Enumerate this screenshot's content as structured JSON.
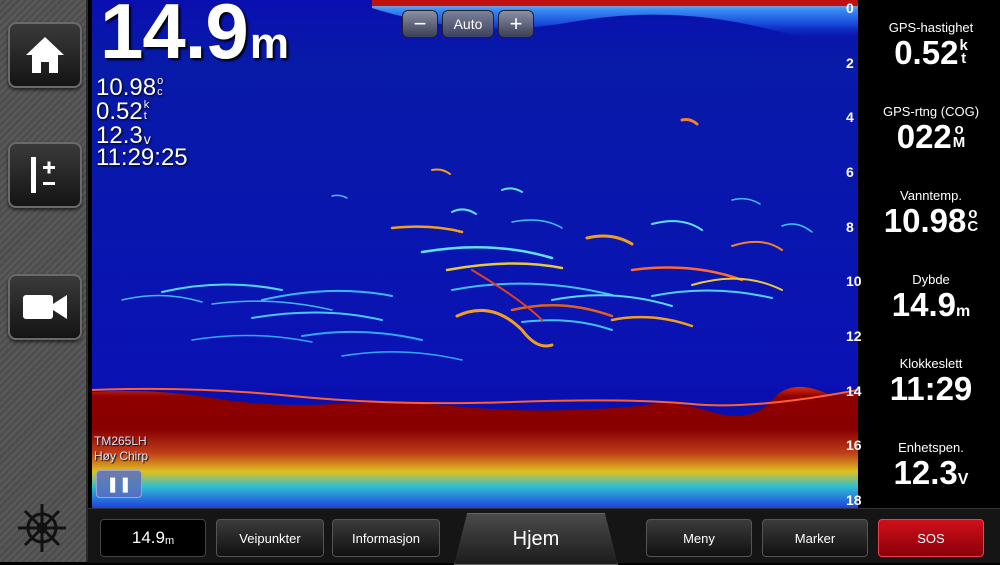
{
  "overlay": {
    "depth_value": "14.9",
    "depth_unit": "m",
    "water_temp": "10.98",
    "water_temp_unit_a": "o",
    "water_temp_unit_b": "c",
    "speed": "0.52",
    "speed_unit_a": "k",
    "speed_unit_b": "t",
    "voltage": "12.3",
    "voltage_unit": "v",
    "time": "11:29:25",
    "transducer": "TM265LH",
    "frequency": "Høy Chirp"
  },
  "zoom": {
    "minus": "−",
    "mode": "Auto",
    "plus": "+"
  },
  "depth_scale": [
    "0",
    "2",
    "4",
    "6",
    "8",
    "10",
    "12",
    "14",
    "16",
    "18"
  ],
  "data_fields": [
    {
      "label": "GPS-hastighet",
      "value": "0.52",
      "unit_a": "k",
      "unit_b": "t"
    },
    {
      "label": "GPS-rtng (COG)",
      "value": "022",
      "unit_a": "o",
      "unit_b": "M"
    },
    {
      "label": "Vanntemp.",
      "value": "10.98",
      "unit_a": "o",
      "unit_b": "C"
    },
    {
      "label": "Dybde",
      "value": "14.9",
      "unit_a": "m",
      "unit_b": ""
    },
    {
      "label": "Klokkeslett",
      "value": "11:29",
      "unit_a": "",
      "unit_b": ""
    },
    {
      "label": "Enhetspen.",
      "value": "12.3",
      "unit_a": "V",
      "unit_b": ""
    }
  ],
  "bottom_bar": {
    "depth_value": "14.9",
    "depth_unit": "m",
    "waypoints": "Veipunkter",
    "info": "Informasjon",
    "home": "Hjem",
    "menu": "Meny",
    "mark": "Marker",
    "sos": "SOS"
  },
  "icons": {
    "home": "home-icon",
    "range": "range-adjust-icon",
    "camera": "video-camera-icon",
    "helm": "ship-wheel-icon"
  },
  "colors": {
    "water": "#0a12b4",
    "bottom": "#8b0000",
    "sos": "#c0101a"
  }
}
